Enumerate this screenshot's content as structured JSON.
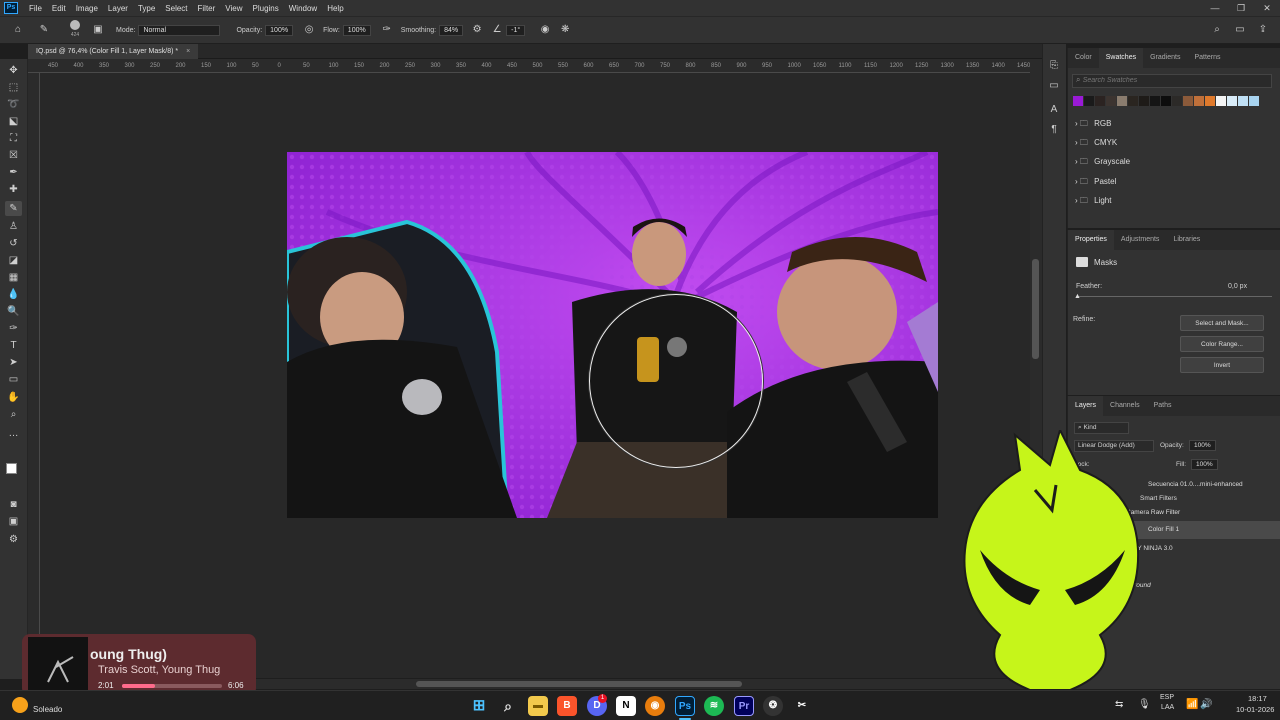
{
  "menu": {
    "app_icon": "Ps",
    "items": [
      "File",
      "Edit",
      "Image",
      "Layer",
      "Type",
      "Select",
      "Filter",
      "View",
      "Plugins",
      "Window",
      "Help"
    ]
  },
  "window_controls": [
    "—",
    "❐",
    "✕"
  ],
  "options_bar": {
    "brush_size": "424",
    "mode_label": "Mode:",
    "mode_value": "Normal",
    "opacity_label": "Opacity:",
    "opacity_value": "100%",
    "flow_label": "Flow:",
    "flow_value": "100%",
    "smoothing_label": "Smoothing:",
    "smoothing_value": "84%",
    "angle_value": "-1°"
  },
  "document_tab": {
    "title": "IQ.psd @ 76,4% (Color Fill 1, Layer Mask/8) *",
    "close": "×"
  },
  "ruler_ticks": [
    "450",
    "400",
    "350",
    "300",
    "250",
    "200",
    "150",
    "100",
    "50",
    "0",
    "50",
    "100",
    "150",
    "200",
    "250",
    "300",
    "350",
    "400",
    "450",
    "500",
    "550",
    "600",
    "650",
    "700",
    "750",
    "800",
    "850",
    "900",
    "950",
    "1000",
    "1050",
    "1100",
    "1150",
    "1200",
    "1250",
    "1300",
    "1350",
    "1400",
    "1450",
    "1500",
    "1550"
  ],
  "swatches_panel": {
    "tabs": [
      "Color",
      "Swatches",
      "Gradients",
      "Patterns"
    ],
    "active_tab": "Swatches",
    "search_placeholder": "Search Swatches",
    "colors": [
      "#9a1ad6",
      "#1a1a1a",
      "#2b2321",
      "#3c3430",
      "#8a7c6e",
      "#2a2520",
      "#1e1b18",
      "#151515",
      "#0d0d0d",
      "#2c2a28",
      "#8b5a3a",
      "#c0703a",
      "#e07a2c",
      "#f4f4f4",
      "#d9ecf8",
      "#bfe0f5",
      "#a8d4f0"
    ],
    "folders": [
      "RGB",
      "CMYK",
      "Grayscale",
      "Pastel",
      "Light"
    ]
  },
  "properties_panel": {
    "tabs": [
      "Properties",
      "Adjustments",
      "Libraries"
    ],
    "active_tab": "Properties",
    "section": "Masks",
    "feather_label": "Feather:",
    "feather_value": "0,0 px",
    "refine_label": "Refine:",
    "buttons": [
      "Select and Mask...",
      "Color Range...",
      "Invert"
    ]
  },
  "layers_panel": {
    "tabs": [
      "Layers",
      "Channels",
      "Paths"
    ],
    "active_tab": "Layers",
    "filter_kind": "Kind",
    "blend_mode": "Linear Dodge (Add)",
    "opacity_label": "Opacity:",
    "opacity_value": "100%",
    "lock_label": "Lock:",
    "fill_label": "Fill:",
    "fill_value": "100%",
    "layers": [
      {
        "name": "Secuencia 01.0....mini-enhanced"
      },
      {
        "name": "Smart Filters"
      },
      {
        "name": "Camera Raw Filter"
      },
      {
        "name": "Color Fill 1"
      },
      {
        "name": "BY NINJA 3.0"
      },
      {
        "name": "Background"
      }
    ]
  },
  "music_widget": {
    "title": "oung Thug)",
    "artist": "Travis Scott, Young Thug",
    "elapsed": "2:01",
    "total": "6:06",
    "progress": 0.33
  },
  "taskbar": {
    "weather": "Soleado",
    "lang_top": "ESP",
    "lang_bottom": "LAA",
    "time": "18:17",
    "date": "10-01-2026",
    "notification_badge": "1",
    "apps": [
      "windows",
      "search",
      "explorer",
      "brave",
      "discord",
      "notion",
      "blender",
      "photoshop",
      "spotify",
      "premiere",
      "davinci",
      "capcut"
    ]
  }
}
